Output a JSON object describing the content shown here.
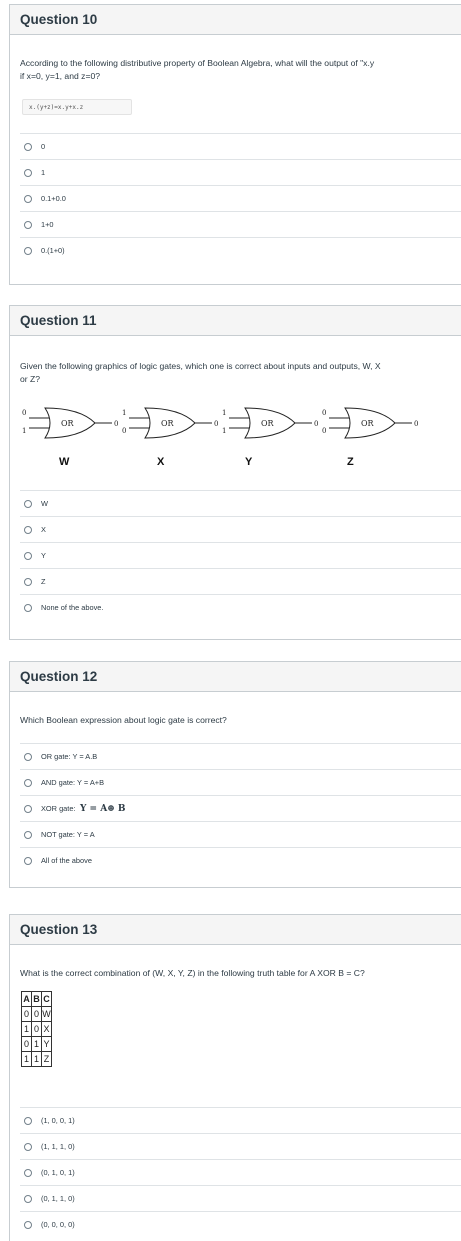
{
  "q10": {
    "title": "Question 10",
    "text_line1": "According to the following distributive property of Boolean Algebra, what will the output of \"x.y",
    "text_line2": "if x=0, y=1, and z=0?",
    "code": "x.(y+z)=x.y+x.z",
    "answers": [
      "0",
      "1",
      "0.1+0.0",
      "1+0",
      "0.(1+0)"
    ]
  },
  "q11": {
    "title": "Question 11",
    "text_line1": "Given the following graphics of logic gates, which one is correct about inputs and outputs, W, X",
    "text_line2": "or Z?",
    "gates": [
      {
        "caption": "W",
        "in_top": "0",
        "in_bottom": "1",
        "label": "OR",
        "output": "0"
      },
      {
        "caption": "X",
        "in_top": "1",
        "in_bottom": "0",
        "label": "OR",
        "output": "0"
      },
      {
        "caption": "Y",
        "in_top": "1",
        "in_bottom": "1",
        "label": "OR",
        "output": "0"
      },
      {
        "caption": "Z",
        "in_top": "0",
        "in_bottom": "0",
        "label": "OR",
        "output": "0"
      }
    ],
    "answers": [
      "W",
      "X",
      "Y",
      "Z",
      "None of the above."
    ]
  },
  "q12": {
    "title": "Question 12",
    "text": "Which Boolean expression about logic gate is correct?",
    "answers": [
      "OR gate: Y = A.B",
      "AND gate: Y = A+B",
      "XOR gate:",
      "NOT gate: Y = A",
      "All of the above"
    ],
    "xor_formula": "Y = A⊕ B"
  },
  "q13": {
    "title": "Question 13",
    "text": "What is the correct combination of (W, X, Y, Z) in the following truth table for A XOR B = C?",
    "table_header": [
      "A",
      "B",
      "C"
    ],
    "table_rows": [
      [
        "0",
        "0",
        "W"
      ],
      [
        "1",
        "0",
        "X"
      ],
      [
        "0",
        "1",
        "Y"
      ],
      [
        "1",
        "1",
        "Z"
      ]
    ],
    "answers": [
      "(1, 0, 0, 1)",
      "(1, 1, 1, 0)",
      "(0, 1, 0, 1)",
      "(0, 1, 1, 0)",
      "(0, 0, 0, 0)"
    ]
  }
}
